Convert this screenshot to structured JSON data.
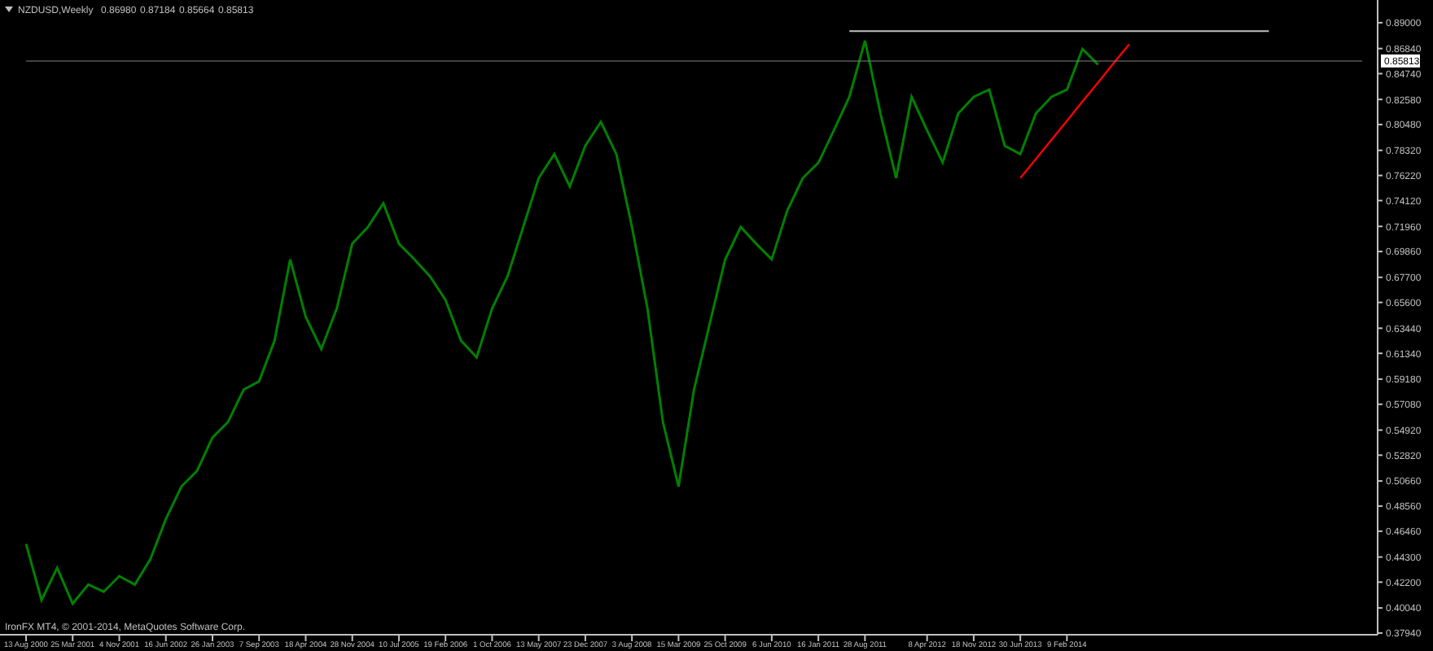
{
  "chart": {
    "header": {
      "symbol": "NZDUSD,Weekly",
      "quotes": [
        "0.86980",
        "0.87184",
        "0.85664",
        "0.85813"
      ]
    },
    "footer": "IronFX MT4, © 2001-2014, MetaQuotes Software Corp.",
    "current_price_label": "0.85813",
    "chart_data": {
      "type": "line",
      "ylim": [
        0.378,
        0.909
      ],
      "categories": [
        "13 Aug 2000",
        null,
        null,
        "25 Mar 2001",
        null,
        null,
        "4 Nov 2001",
        null,
        null,
        "16 Jun 2002",
        null,
        null,
        "26 Jan 2003",
        null,
        null,
        "7 Sep 2003",
        null,
        null,
        "18 Apr 2004",
        null,
        null,
        "28 Nov 2004",
        null,
        null,
        "10 Jul 2005",
        null,
        null,
        "19 Feb 2006",
        null,
        null,
        "1 Oct 2006",
        null,
        null,
        "13 May 2007",
        null,
        null,
        "23 Dec 2007",
        null,
        null,
        "3 Aug 2008",
        null,
        null,
        "15 Mar 2009",
        null,
        null,
        "25 Oct 2009",
        null,
        null,
        "6 Jun 2010",
        null,
        null,
        "16 Jan 2011",
        null,
        null,
        "28 Aug 2011",
        null,
        null,
        null,
        "8 Apr 2012",
        null,
        null,
        "18 Nov 2012",
        null,
        null,
        "30 Jun 2013",
        null,
        null,
        "9 Feb 2014",
        null,
        null,
        null,
        null,
        null,
        null,
        null,
        null,
        null,
        null,
        null,
        null,
        null,
        null,
        null,
        null,
        null,
        null,
        null
      ],
      "series": [
        {
          "color": "#008000",
          "values": [
            0.454,
            0.407,
            0.434,
            0.404,
            0.42,
            0.414,
            0.427,
            0.42,
            0.441,
            0.475,
            0.502,
            0.515,
            0.543,
            0.556,
            0.583,
            0.59,
            0.624,
            0.692,
            0.644,
            0.617,
            0.651,
            0.705,
            0.719,
            0.739,
            0.705,
            0.692,
            0.678,
            0.658,
            0.624,
            0.61,
            0.651,
            0.678,
            0.719,
            0.76,
            0.78,
            0.753,
            0.787,
            0.807,
            0.78,
            0.719,
            0.651,
            0.556,
            0.502,
            0.583,
            0.638,
            0.692,
            0.719,
            0.705,
            0.692,
            0.733,
            0.76,
            0.773,
            0.8,
            0.828,
            0.875,
            0.814,
            0.76,
            0.828,
            0.8,
            0.773,
            0.814,
            0.828,
            0.834,
            0.787,
            0.78,
            0.814,
            0.828,
            0.834,
            0.868,
            0.855,
            null,
            null,
            null,
            null,
            null,
            null,
            null,
            null,
            null,
            null,
            null,
            null,
            null,
            null,
            null,
            null,
            null
          ]
        },
        {
          "color": "#c0c0c0",
          "values": [
            null,
            null,
            null,
            null,
            null,
            null,
            null,
            null,
            null,
            null,
            null,
            null,
            null,
            null,
            null,
            null,
            null,
            null,
            null,
            null,
            null,
            null,
            null,
            null,
            null,
            null,
            null,
            null,
            null,
            null,
            null,
            null,
            null,
            null,
            null,
            null,
            null,
            null,
            null,
            null,
            null,
            null,
            null,
            null,
            null,
            null,
            null,
            null,
            null,
            null,
            null,
            null,
            null,
            0.883,
            0.883,
            0.883,
            0.883,
            0.883,
            0.883,
            0.883,
            0.883,
            0.883,
            0.883,
            0.883,
            0.883,
            0.883,
            0.883,
            0.883,
            0.883,
            0.883,
            0.883,
            0.883,
            0.883,
            0.883,
            0.883,
            0.883,
            0.883,
            0.883,
            0.883,
            0.883,
            0.883,
            null,
            null,
            null,
            null,
            null,
            null
          ]
        },
        {
          "color": "#ff0000",
          "values": [
            null,
            null,
            null,
            null,
            null,
            null,
            null,
            null,
            null,
            null,
            null,
            null,
            null,
            null,
            null,
            null,
            null,
            null,
            null,
            null,
            null,
            null,
            null,
            null,
            null,
            null,
            null,
            null,
            null,
            null,
            null,
            null,
            null,
            null,
            null,
            null,
            null,
            null,
            null,
            null,
            null,
            null,
            null,
            null,
            null,
            null,
            null,
            null,
            null,
            null,
            null,
            null,
            null,
            null,
            null,
            null,
            null,
            null,
            null,
            null,
            null,
            null,
            null,
            null,
            0.76,
            0.776,
            0.792,
            0.808,
            0.824,
            0.84,
            0.856,
            0.872,
            null,
            null,
            null,
            null,
            null,
            null,
            null,
            null,
            null,
            null,
            null,
            null,
            null,
            null,
            null
          ]
        },
        {
          "color": "#808080",
          "values": [
            0.858,
            0.858,
            0.858,
            0.858,
            0.858,
            0.858,
            0.858,
            0.858,
            0.858,
            0.858,
            0.858,
            0.858,
            0.858,
            0.858,
            0.858,
            0.858,
            0.858,
            0.858,
            0.858,
            0.858,
            0.858,
            0.858,
            0.858,
            0.858,
            0.858,
            0.858,
            0.858,
            0.858,
            0.858,
            0.858,
            0.858,
            0.858,
            0.858,
            0.858,
            0.858,
            0.858,
            0.858,
            0.858,
            0.858,
            0.858,
            0.858,
            0.858,
            0.858,
            0.858,
            0.858,
            0.858,
            0.858,
            0.858,
            0.858,
            0.858,
            0.858,
            0.858,
            0.858,
            0.858,
            0.858,
            0.858,
            0.858,
            0.858,
            0.858,
            0.858,
            0.858,
            0.858,
            0.858,
            0.858,
            0.858,
            0.858,
            0.858,
            0.858,
            0.858,
            0.858,
            0.858,
            0.858,
            0.858,
            0.858,
            0.858,
            0.858,
            0.858,
            0.858,
            0.858,
            0.858,
            0.858,
            0.858,
            0.858,
            0.858,
            0.858,
            0.858,
            0.858
          ]
        }
      ],
      "yticks": [
        {
          "value": 0.89,
          "label": "0.89000"
        },
        {
          "value": 0.8684,
          "label": "0.86840"
        },
        {
          "value": 0.8474,
          "label": "0.84740"
        },
        {
          "value": 0.8258,
          "label": "0.82580"
        },
        {
          "value": 0.8048,
          "label": "0.80480"
        },
        {
          "value": 0.7832,
          "label": "0.78320"
        },
        {
          "value": 0.7622,
          "label": "0.76220"
        },
        {
          "value": 0.7412,
          "label": "0.74120"
        },
        {
          "value": 0.7196,
          "label": "0.71960"
        },
        {
          "value": 0.6986,
          "label": "0.69860"
        },
        {
          "value": 0.677,
          "label": "0.67700"
        },
        {
          "value": 0.656,
          "label": "0.65600"
        },
        {
          "value": 0.6344,
          "label": "0.63440"
        },
        {
          "value": 0.6134,
          "label": "0.61340"
        },
        {
          "value": 0.5918,
          "label": "0.59180"
        },
        {
          "value": 0.5708,
          "label": "0.57080"
        },
        {
          "value": 0.5492,
          "label": "0.54920"
        },
        {
          "value": 0.5282,
          "label": "0.52820"
        },
        {
          "value": 0.5066,
          "label": "0.50660"
        },
        {
          "value": 0.4856,
          "label": "0.48560"
        },
        {
          "value": 0.4646,
          "label": "0.46460"
        },
        {
          "value": 0.443,
          "label": "0.44300"
        },
        {
          "value": 0.422,
          "label": "0.42200"
        },
        {
          "value": 0.4004,
          "label": "0.40040"
        },
        {
          "value": 0.3794,
          "label": "0.37940"
        }
      ]
    }
  }
}
